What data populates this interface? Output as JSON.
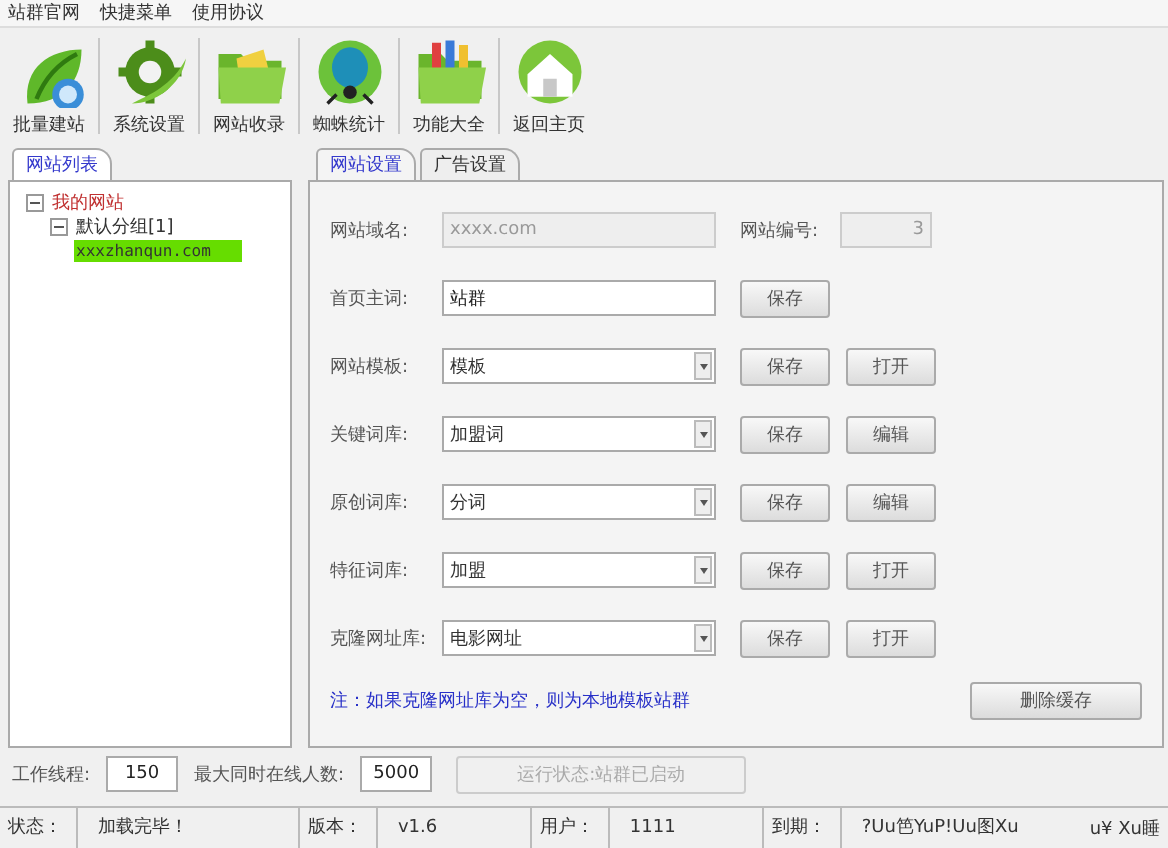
{
  "menu": [
    "站群官网",
    "快捷菜单",
    "使用协议"
  ],
  "toolbar": [
    {
      "label": "批量建站"
    },
    {
      "label": "系统设置"
    },
    {
      "label": "网站收录"
    },
    {
      "label": "蜘蛛统计"
    },
    {
      "label": "功能大全"
    },
    {
      "label": "返回主页"
    }
  ],
  "site_list": {
    "tab": "网站列表",
    "tree": [
      {
        "label": "我的网站",
        "expanded": true,
        "selected": false,
        "children": [
          {
            "label": "默认分组[1]",
            "expanded": true,
            "selected": false,
            "children": [
              {
                "label": "xxxzhanqun.com",
                "selected": true
              }
            ]
          }
        ]
      }
    ]
  },
  "settings": {
    "tabs": [
      {
        "label": "网站设置",
        "selected": true
      },
      {
        "label": "广告设置",
        "selected": false
      }
    ],
    "domain": {
      "label": "网站域名:",
      "value": "xxxx.com",
      "disabled": true
    },
    "site_number": {
      "label": "网站编号:",
      "value": "3",
      "disabled": true
    },
    "rows": [
      {
        "label": "首页主词:",
        "kind": "text",
        "value": "站群",
        "buttons": [
          "保存"
        ]
      },
      {
        "label": "网站模板:",
        "kind": "select",
        "value": "模板",
        "buttons": [
          "保存",
          "打开"
        ]
      },
      {
        "label": "关键词库:",
        "kind": "select",
        "value": "加盟词",
        "buttons": [
          "保存",
          "编辑"
        ]
      },
      {
        "label": "原创词库:",
        "kind": "select",
        "value": "分词",
        "buttons": [
          "保存",
          "编辑"
        ]
      },
      {
        "label": "特征词库:",
        "kind": "select",
        "value": "加盟",
        "buttons": [
          "保存",
          "打开"
        ]
      },
      {
        "label": "克隆网址库:",
        "kind": "select",
        "value": "电影网址",
        "buttons": [
          "保存",
          "打开"
        ]
      }
    ],
    "note": "注：如果克隆网址库为空，则为本地模板站群",
    "delete_cache_button": "删除缓存"
  },
  "bottom": {
    "threads_label": "工作线程:",
    "threads": "150",
    "max_online_label": "最大同时在线人数:",
    "max_online": "5000",
    "run_status": "运行状态:站群已启动",
    "run_status_disabled": true
  },
  "status_bar": [
    {
      "label": "状态：",
      "value": "加载完毕！"
    },
    {
      "label": "版本：",
      "value": "v1.6"
    },
    {
      "label": "用户：",
      "value": "1111"
    },
    {
      "label": "到期：",
      "value": "?Uu笆YuP!Uu图Xu"
    }
  ],
  "status_extra": "u¥ Xu睡"
}
